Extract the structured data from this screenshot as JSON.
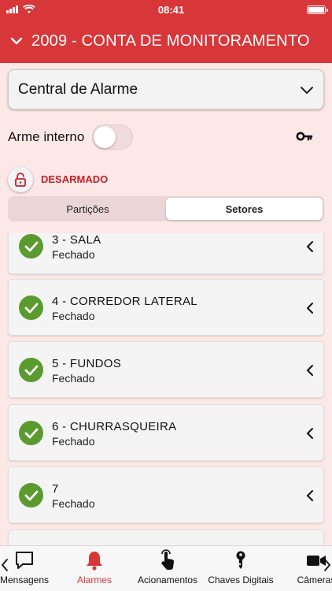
{
  "status_bar": {
    "time": "08:41"
  },
  "header": {
    "title": "2009 - CONTA DE MONITORAMENTO"
  },
  "dropdown": {
    "value": "Central de Alarme"
  },
  "arme_interno": {
    "label": "Arme interno",
    "enabled": false
  },
  "alarm_status": {
    "text": "DESARMADO"
  },
  "segments": [
    {
      "label": "Partições",
      "active": false
    },
    {
      "label": "Setores",
      "active": true
    }
  ],
  "sectors": [
    {
      "name": "3 - SALA",
      "state": "Fechado"
    },
    {
      "name": "4 - CORREDOR LATERAL",
      "state": "Fechado"
    },
    {
      "name": "5 - FUNDOS",
      "state": "Fechado"
    },
    {
      "name": "6 - CHURRASQUEIRA",
      "state": "Fechado"
    },
    {
      "name": "7",
      "state": "Fechado"
    }
  ],
  "tabs": [
    {
      "label": "Mensagens",
      "icon": "chat-icon",
      "active": false
    },
    {
      "label": "Alarmes",
      "icon": "bell-icon",
      "active": true
    },
    {
      "label": "Acionamentos",
      "icon": "tap-hand-icon",
      "active": false
    },
    {
      "label": "Chaves Digitais",
      "icon": "key-icon",
      "active": false
    },
    {
      "label": "Câmeras",
      "icon": "video-camera-icon",
      "active": false
    }
  ],
  "colors": {
    "brand_red": "#d8373a",
    "background": "#fde8e8",
    "check_green": "#5a9a2f",
    "disarmed_text": "#c8202a"
  }
}
